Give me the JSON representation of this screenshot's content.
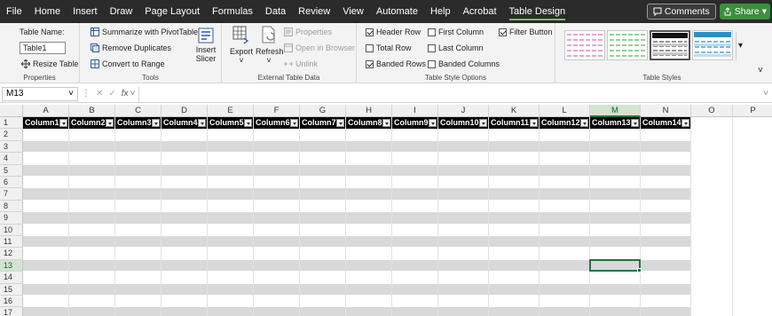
{
  "menu": {
    "tabs": [
      "File",
      "Home",
      "Insert",
      "Draw",
      "Page Layout",
      "Formulas",
      "Data",
      "Review",
      "View",
      "Automate",
      "Help",
      "Acrobat",
      "Table Design"
    ],
    "active_tab": "Table Design",
    "comments_label": "Comments",
    "share_label": "Share"
  },
  "ribbon": {
    "properties": {
      "table_name_label": "Table Name:",
      "table_name_value": "Table1",
      "resize_label": "Resize Table",
      "group_label": "Properties"
    },
    "tools": {
      "summarize_label": "Summarize with PivotTable",
      "remove_dup_label": "Remove Duplicates",
      "convert_label": "Convert to Range",
      "insert_slicer_line1": "Insert",
      "insert_slicer_line2": "Slicer",
      "group_label": "Tools"
    },
    "external": {
      "export_label": "Export",
      "refresh_label": "Refresh",
      "properties_label": "Properties",
      "open_browser_label": "Open in Browser",
      "unlink_label": "Unlink",
      "group_label": "External Table Data"
    },
    "style_options": {
      "header_row": "Header Row",
      "total_row": "Total Row",
      "banded_rows": "Banded Rows",
      "first_column": "First Column",
      "last_column": "Last Column",
      "banded_columns": "Banded Columns",
      "filter_button": "Filter Button",
      "group_label": "Table Style Options"
    },
    "table_styles": {
      "group_label": "Table Styles"
    }
  },
  "formula_bar": {
    "name_box": "M13",
    "fx": "fx",
    "value": ""
  },
  "sheet": {
    "columns": [
      "A",
      "B",
      "C",
      "D",
      "E",
      "F",
      "G",
      "H",
      "I",
      "J",
      "K",
      "L",
      "M",
      "N",
      "O",
      "P"
    ],
    "rows": [
      "1",
      "2",
      "3",
      "4",
      "5",
      "6",
      "7",
      "8",
      "9",
      "10",
      "11",
      "12",
      "13",
      "14",
      "15",
      "16",
      "17"
    ],
    "table_headers": [
      "Column1",
      "Column2",
      "Column3",
      "Column4",
      "Column5",
      "Column6",
      "Column7",
      "Column8",
      "Column9",
      "Column10",
      "Column11",
      "Column12",
      "Column13",
      "Column14"
    ],
    "selected_cell": "M13"
  },
  "colors": {
    "accent": "#217346",
    "band": "#d9d9d9",
    "header_fill": "#000000"
  }
}
